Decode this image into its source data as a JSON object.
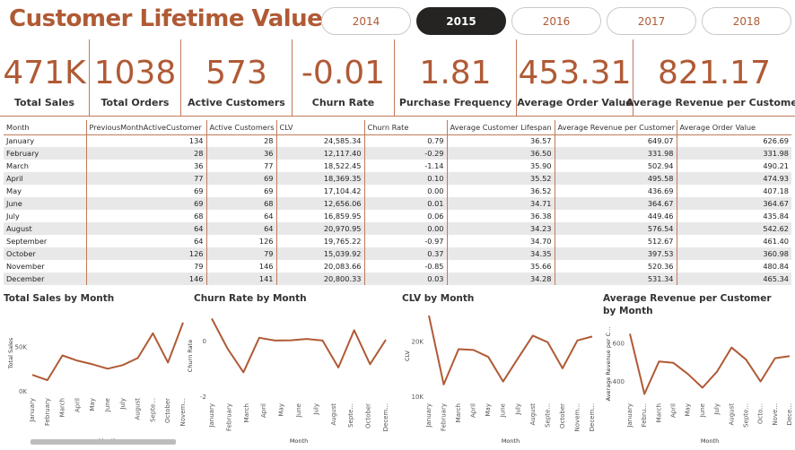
{
  "page": {
    "title": "Customer Lifetime Value"
  },
  "years": [
    {
      "label": "2014",
      "active": false
    },
    {
      "label": "2015",
      "active": true
    },
    {
      "label": "2016",
      "active": false
    },
    {
      "label": "2017",
      "active": false
    },
    {
      "label": "2018",
      "active": false
    }
  ],
  "kpis": [
    {
      "value": "471K",
      "label": "Total Sales"
    },
    {
      "value": "1038",
      "label": "Total Orders"
    },
    {
      "value": "573",
      "label": "Active Customers"
    },
    {
      "value": "-0.01",
      "label": "Churn Rate"
    },
    {
      "value": "1.81",
      "label": "Purchase Frequency"
    },
    {
      "value": "453.31",
      "label": "Average Order Value"
    },
    {
      "value": "821.17",
      "label": "Average Revenue per Customer"
    }
  ],
  "table": {
    "columns": [
      "Month",
      "PreviousMonthActiveCustomer",
      "Active Customers",
      "CLV",
      "Churn Rate",
      "Average Customer Lifespan",
      "Average Revenue per Customer",
      "Average Order Value"
    ],
    "rows": [
      [
        "January",
        "134",
        "28",
        "24,585.34",
        "0.79",
        "36.57",
        "649.07",
        "626.69"
      ],
      [
        "February",
        "28",
        "36",
        "12,117.40",
        "-0.29",
        "36.50",
        "331.98",
        "331.98"
      ],
      [
        "March",
        "36",
        "77",
        "18,522.45",
        "-1.14",
        "35.90",
        "502.94",
        "490.21"
      ],
      [
        "April",
        "77",
        "69",
        "18,369.35",
        "0.10",
        "35.52",
        "495.58",
        "474.93"
      ],
      [
        "May",
        "69",
        "69",
        "17,104.42",
        "0.00",
        "36.52",
        "436.69",
        "407.18"
      ],
      [
        "June",
        "69",
        "68",
        "12,656.06",
        "0.01",
        "34.71",
        "364.67",
        "364.67"
      ],
      [
        "July",
        "68",
        "64",
        "16,859.95",
        "0.06",
        "36.38",
        "449.46",
        "435.84"
      ],
      [
        "August",
        "64",
        "64",
        "20,970.95",
        "0.00",
        "34.23",
        "576.54",
        "542.62"
      ],
      [
        "September",
        "64",
        "126",
        "19,765.22",
        "-0.97",
        "34.70",
        "512.67",
        "461.40"
      ],
      [
        "October",
        "126",
        "79",
        "15,039.92",
        "0.37",
        "34.35",
        "397.53",
        "360.98"
      ],
      [
        "November",
        "79",
        "146",
        "20,083.66",
        "-0.85",
        "35.66",
        "520.36",
        "480.84"
      ],
      [
        "December",
        "146",
        "141",
        "20,800.33",
        "0.03",
        "34.28",
        "531.34",
        "465.34"
      ]
    ]
  },
  "charts": {
    "line_color": "#b05a35",
    "x_axis_label": "Month"
  },
  "chart_data": [
    {
      "type": "line",
      "title": "Total Sales by Month",
      "xlabel": "Month",
      "ylabel": "Total Sales",
      "categories": [
        "January",
        "February",
        "March",
        "April",
        "May",
        "June",
        "July",
        "August",
        "Septe...",
        "October",
        "Novem..."
      ],
      "values": [
        18000,
        12000,
        40000,
        34000,
        30000,
        25000,
        29000,
        37000,
        65000,
        32000,
        77000
      ],
      "yticks": [
        {
          "v": 0,
          "label": "0K"
        },
        {
          "v": 50000,
          "label": "50K"
        }
      ],
      "ylim": [
        0,
        85000
      ]
    },
    {
      "type": "line",
      "title": "Churn Rate by Month",
      "xlabel": "Month",
      "ylabel": "Churn Rate",
      "categories": [
        "January",
        "February",
        "March",
        "April",
        "May",
        "June",
        "July",
        "August",
        "Septe...",
        "October",
        "Decem..."
      ],
      "values": [
        0.79,
        -0.29,
        -1.14,
        0.1,
        0.0,
        0.01,
        0.06,
        0.0,
        -0.97,
        0.37,
        -0.85,
        0.03
      ],
      "yticks": [
        {
          "v": 0,
          "label": "0"
        },
        {
          "v": -2,
          "label": "-2"
        }
      ],
      "ylim": [
        -2,
        0.9
      ]
    },
    {
      "type": "line",
      "title": "CLV by Month",
      "xlabel": "Month",
      "ylabel": "CLV",
      "categories": [
        "January",
        "February",
        "March",
        "April",
        "May",
        "June",
        "July",
        "August",
        "Septe...",
        "October",
        "Novem...",
        "Decem..."
      ],
      "values": [
        24585.34,
        12117.4,
        18522.45,
        18369.35,
        17104.42,
        12656.06,
        16859.95,
        20970.95,
        19765.22,
        15039.92,
        20083.66,
        20800.33
      ],
      "yticks": [
        {
          "v": 10000,
          "label": "10K"
        },
        {
          "v": 20000,
          "label": "20K"
        }
      ],
      "ylim": [
        10000,
        24600
      ]
    },
    {
      "type": "line",
      "title": "Average Revenue per Customer by Month",
      "xlabel": "Month",
      "ylabel": "Average Revenue per C...",
      "categories": [
        "January",
        "Febru...",
        "March",
        "April",
        "May",
        "June",
        "July",
        "August",
        "Septe...",
        "Octo...",
        "Nove...",
        "Dece..."
      ],
      "values": [
        649.07,
        331.98,
        502.94,
        495.58,
        436.69,
        364.67,
        449.46,
        576.54,
        512.67,
        397.53,
        520.36,
        531.34
      ],
      "yticks": [
        {
          "v": 400,
          "label": "400"
        },
        {
          "v": 600,
          "label": "600"
        }
      ],
      "ylim": [
        320,
        660
      ]
    }
  ]
}
